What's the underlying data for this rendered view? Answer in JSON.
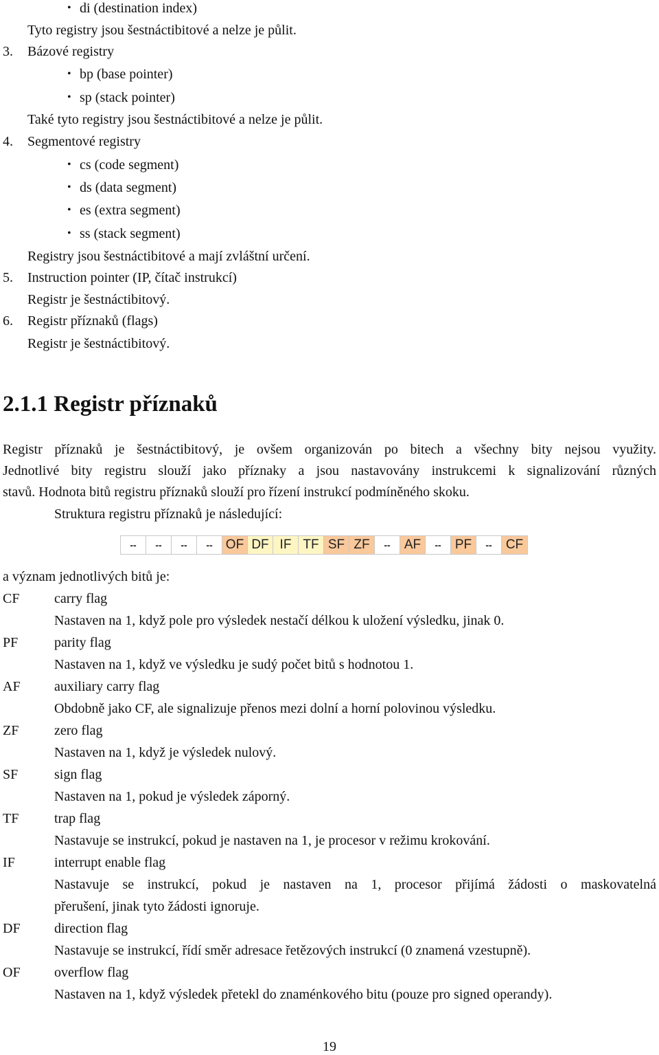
{
  "top_list": {
    "item_di": "di (destination index)",
    "note_index": "Tyto registry jsou šestnáctibitové a nelze je půlit.",
    "section3": {
      "number": "3.",
      "title": "Bázové registry"
    },
    "item_bp": "bp (base pointer)",
    "item_sp": "sp (stack pointer)",
    "note_base": "Také tyto registry jsou šestnáctibitové a nelze je půlit.",
    "section4": {
      "number": "4.",
      "title": "Segmentové registry"
    },
    "item_cs": "cs (code segment)",
    "item_ds": "ds (data segment)",
    "item_es": "es (extra segment)",
    "item_ss": "ss (stack segment)",
    "note_segment": "Registry jsou šestnáctibitové a mají zvláštní určení.",
    "section5": {
      "number": "5.",
      "title": "Instruction pointer (IP, čítač instrukcí)"
    },
    "note_ip": "Registr je šestnáctibitový.",
    "section6": {
      "number": "6.",
      "title": "Registr příznaků (flags)"
    },
    "note_flags": "Registr je šestnáctibitový.",
    "bullet_glyph": "•"
  },
  "section": {
    "heading": "2.1.1 Registr příznaků",
    "para_line1": "Registr příznaků je šestnáctibitový, je ovšem organizován po bitech a všechny bity nejsou využity.",
    "para_line2": "Jednotlivé bity registru slouží jako příznaky a jsou nastavovány instrukcemi k signalizování různých",
    "para_line3": "stavů. Hodnota bitů registru příznaků slouží pro řízení instrukcí podmíněného skoku.",
    "structure_intro": "Struktura registru příznaků je následující:",
    "meaning_intro": "a význam jednotlivých bitů je:"
  },
  "flags_table": {
    "colors": {
      "unused": "#ffffff",
      "status": "#f9c89b",
      "control": "#fdf6c3"
    },
    "cells": [
      {
        "label": "--",
        "kind": "unused"
      },
      {
        "label": "--",
        "kind": "unused"
      },
      {
        "label": "--",
        "kind": "unused"
      },
      {
        "label": "--",
        "kind": "unused"
      },
      {
        "label": "OF",
        "kind": "status"
      },
      {
        "label": "DF",
        "kind": "control"
      },
      {
        "label": "IF",
        "kind": "control"
      },
      {
        "label": "TF",
        "kind": "control"
      },
      {
        "label": "SF",
        "kind": "status"
      },
      {
        "label": "ZF",
        "kind": "status"
      },
      {
        "label": "--",
        "kind": "unused"
      },
      {
        "label": "AF",
        "kind": "status"
      },
      {
        "label": "--",
        "kind": "unused"
      },
      {
        "label": "PF",
        "kind": "status"
      },
      {
        "label": "--",
        "kind": "unused"
      },
      {
        "label": "CF",
        "kind": "status"
      }
    ]
  },
  "flags": [
    {
      "abbr": "CF",
      "name": "carry flag",
      "desc": [
        "Nastaven na 1, když pole pro výsledek nestačí délkou k uložení výsledku, jinak 0."
      ]
    },
    {
      "abbr": "PF",
      "name": "parity flag",
      "desc": [
        "Nastaven na 1, když ve výsledku je sudý počet bitů s hodnotou 1."
      ]
    },
    {
      "abbr": "AF",
      "name": "auxiliary carry flag",
      "desc": [
        "Obdobně jako CF, ale signalizuje přenos mezi dolní a horní polovinou výsledku."
      ]
    },
    {
      "abbr": "ZF",
      "name": "zero flag",
      "desc": [
        "Nastaven na 1, když je výsledek nulový."
      ]
    },
    {
      "abbr": "SF",
      "name": "sign flag",
      "desc": [
        "Nastaven na 1, pokud je výsledek záporný."
      ]
    },
    {
      "abbr": "TF",
      "name": "trap flag",
      "desc": [
        "Nastavuje se instrukcí, pokud je nastaven na 1, je procesor v režimu krokování."
      ]
    },
    {
      "abbr": "IF",
      "name": "interrupt enable flag",
      "desc": [
        "Nastavuje se instrukcí, pokud je nastaven na 1, procesor přijímá žádosti o maskovatelná",
        "přerušení, jinak tyto žádosti ignoruje."
      ]
    },
    {
      "abbr": "DF",
      "name": "direction flag",
      "desc": [
        "Nastavuje se instrukcí, řídí směr adresace řetězových instrukcí (0 znamená vzestupně)."
      ]
    },
    {
      "abbr": "OF",
      "name": "overflow flag",
      "desc": [
        "Nastaven na 1, když výsledek přetekl do znaménkového bitu (pouze pro signed operandy)."
      ]
    }
  ],
  "page_number": "19"
}
